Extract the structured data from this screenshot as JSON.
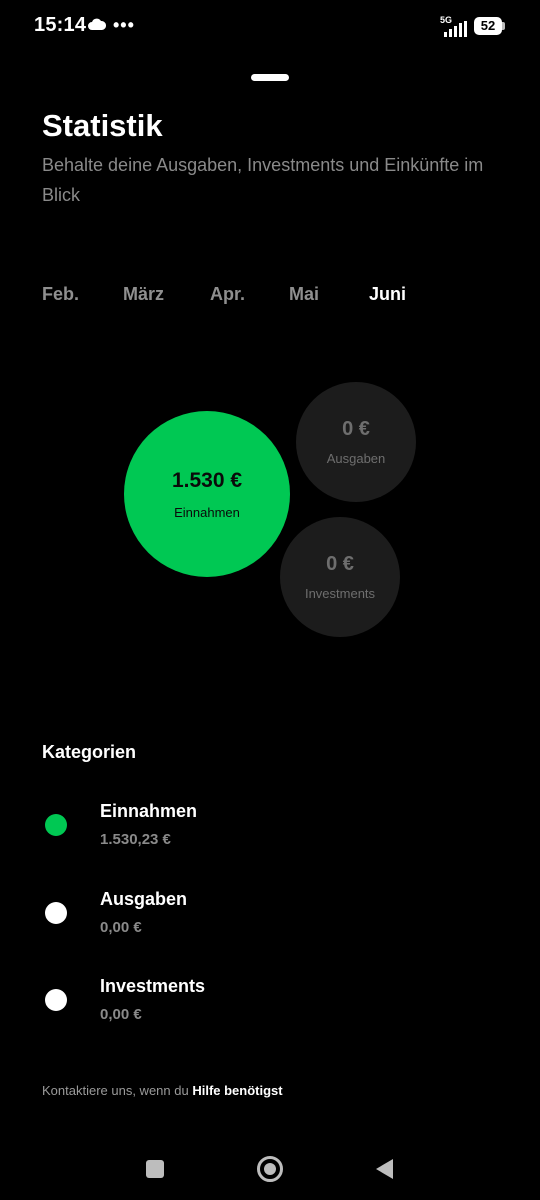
{
  "status_bar": {
    "time": "15:14",
    "network": "5G",
    "battery": "52",
    "icons": [
      "cloud-icon",
      "more-icon",
      "signal-icon",
      "battery-icon"
    ]
  },
  "header": {
    "title": "Statistik",
    "subtitle": "Behalte deine Ausgaben, Investments und Einkünfte im Blick"
  },
  "months": [
    {
      "label": "Feb.",
      "active": false
    },
    {
      "label": "März",
      "active": false
    },
    {
      "label": "Apr.",
      "active": false
    },
    {
      "label": "Mai",
      "active": false
    },
    {
      "label": "Juni",
      "active": true
    }
  ],
  "bubbles": {
    "income": {
      "amount": "1.530 €",
      "label": "Einnahmen",
      "color": "#00c853"
    },
    "expenses": {
      "amount": "0 €",
      "label": "Ausgaben"
    },
    "investments": {
      "amount": "0 €",
      "label": "Investments"
    }
  },
  "categories": {
    "title": "Kategorien",
    "items": [
      {
        "name": "Einnahmen",
        "value": "1.530,23 €",
        "color": "#00c853"
      },
      {
        "name": "Ausgaben",
        "value": "0,00 €",
        "color": "#ffffff"
      },
      {
        "name": "Investments",
        "value": "0,00 €",
        "color": "#ffffff"
      }
    ]
  },
  "footer": {
    "help_text": "Kontaktiere uns, wenn du ",
    "help_link": "Hilfe benötigst"
  },
  "colors": {
    "background": "#000000",
    "accent": "#00c853",
    "muted": "#8a8a8a"
  }
}
